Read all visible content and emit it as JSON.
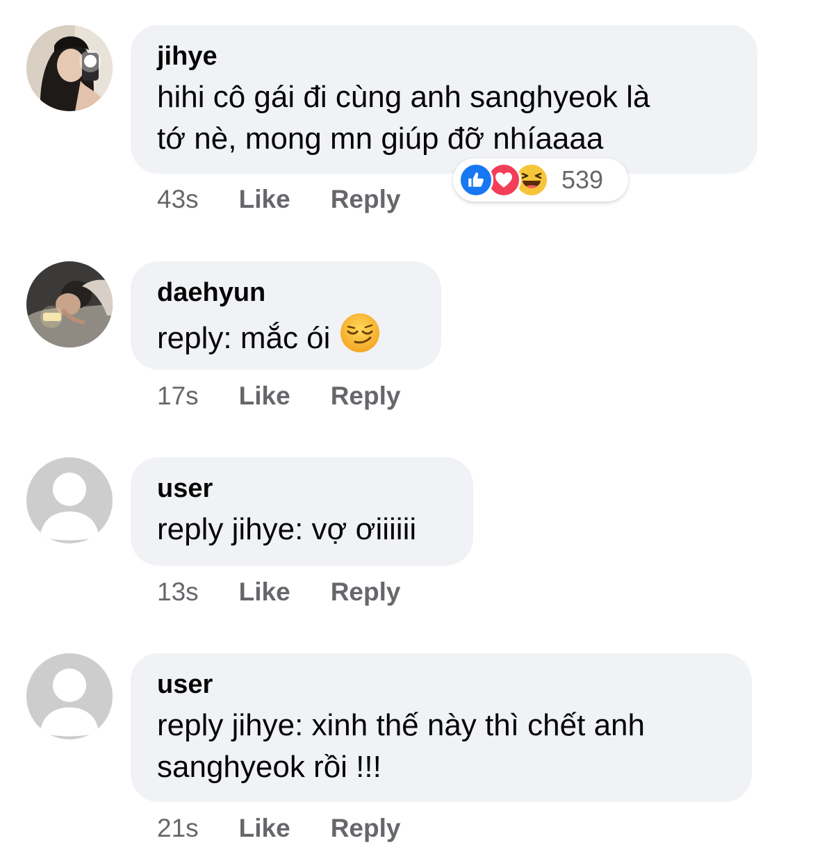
{
  "comments": [
    {
      "author": "jihye",
      "lines": [
        "hihi cô gái đi cùng anh sanghyeok là",
        "tớ nè, mong mn giúp đỡ nhíaaaa"
      ],
      "time": "43s",
      "like_label": "Like",
      "reply_label": "Reply",
      "reactions": {
        "icons": [
          "like-icon",
          "love-icon",
          "haha-icon"
        ],
        "count": "539"
      }
    },
    {
      "author": "daehyun",
      "lines": [
        "reply: mắc ói"
      ],
      "emoji": "smirk-emoji",
      "time": "17s",
      "like_label": "Like",
      "reply_label": "Reply"
    },
    {
      "author": "user",
      "lines": [
        "reply jihye: vợ ơiiiiii"
      ],
      "time": "13s",
      "like_label": "Like",
      "reply_label": "Reply"
    },
    {
      "author": "user",
      "lines": [
        "reply jihye: xinh thế này thì chết anh",
        "sanghyeok rồi !!!"
      ],
      "time": "21s",
      "like_label": "Like",
      "reply_label": "Reply"
    }
  ],
  "colors": {
    "bubble": "#f0f2f5",
    "meta_text": "#65676b",
    "like_blue": "#1877f2",
    "love_red": "#f33e58",
    "haha_yellow": "#f7b125"
  }
}
